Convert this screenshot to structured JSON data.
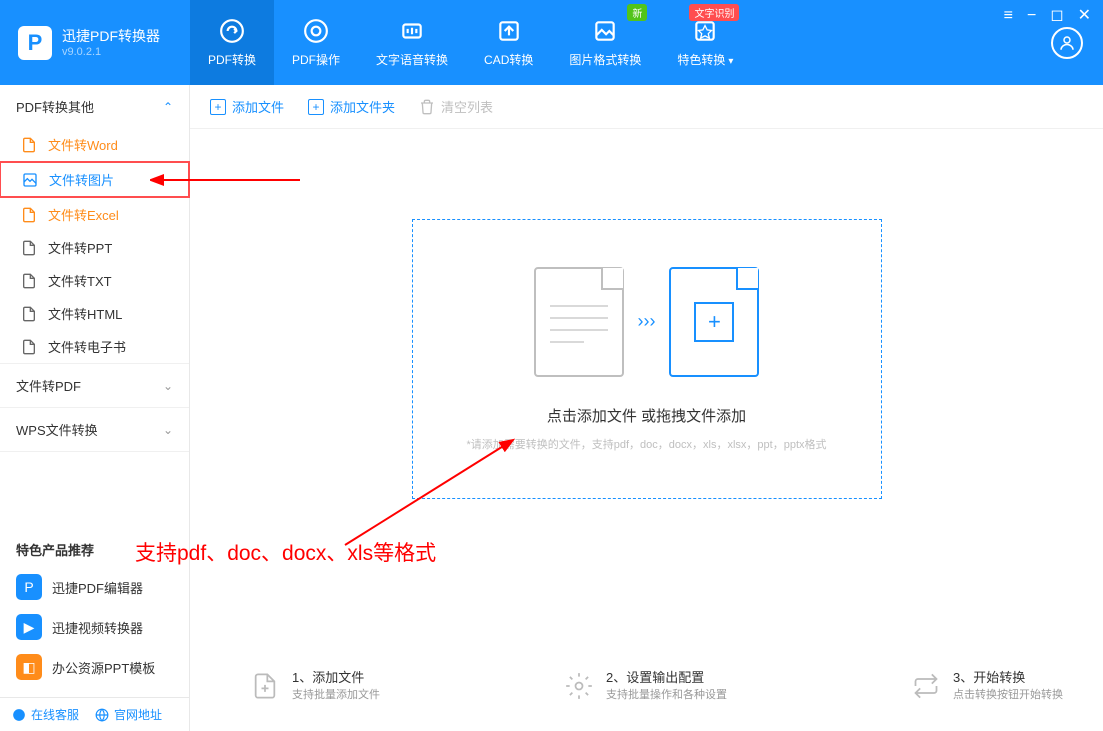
{
  "app": {
    "name": "迅捷PDF转换器",
    "version": "v9.0.2.1"
  },
  "nav": {
    "items": [
      {
        "label": "PDF转换",
        "badge": ""
      },
      {
        "label": "PDF操作",
        "badge": ""
      },
      {
        "label": "文字语音转换",
        "badge": ""
      },
      {
        "label": "CAD转换",
        "badge": ""
      },
      {
        "label": "图片格式转换",
        "badge": "新"
      },
      {
        "label": "特色转换",
        "badge": "文字识别"
      }
    ]
  },
  "sidebar": {
    "sections": [
      {
        "title": "PDF转换其他",
        "expanded": true
      },
      {
        "title": "文件转PDF",
        "expanded": false
      },
      {
        "title": "WPS文件转换",
        "expanded": false
      }
    ],
    "items": [
      {
        "label": "文件转Word"
      },
      {
        "label": "文件转图片"
      },
      {
        "label": "文件转Excel"
      },
      {
        "label": "文件转PPT"
      },
      {
        "label": "文件转TXT"
      },
      {
        "label": "文件转HTML"
      },
      {
        "label": "文件转电子书"
      }
    ],
    "recommend_title": "特色产品推荐",
    "recommends": [
      {
        "label": "迅捷PDF编辑器"
      },
      {
        "label": "迅捷视频转换器"
      },
      {
        "label": "办公资源PPT模板"
      }
    ],
    "footer": {
      "service": "在线客服",
      "official": "官网地址"
    }
  },
  "toolbar": {
    "add_file": "添加文件",
    "add_folder": "添加文件夹",
    "clear_list": "清空列表"
  },
  "dropzone": {
    "title": "点击添加文件 或拖拽文件添加",
    "hint": "*请添加需要转换的文件，支持pdf，doc，docx，xls，xlsx，ppt，pptx格式"
  },
  "annotation": "支持pdf、doc、docx、xls等格式",
  "steps": [
    {
      "title": "1、添加文件",
      "sub": "支持批量添加文件"
    },
    {
      "title": "2、设置输出配置",
      "sub": "支持批量操作和各种设置"
    },
    {
      "title": "3、开始转换",
      "sub": "点击转换按钮开始转换"
    }
  ]
}
